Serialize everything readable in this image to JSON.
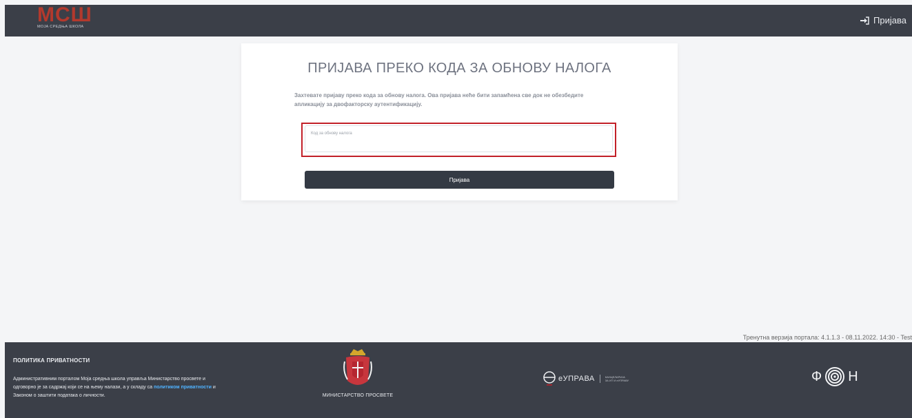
{
  "header": {
    "logo_text": "МСШ",
    "logo_subtitle": "МОЈА СРЕДЊА ШКОЛА",
    "login_label": "Пријава",
    "login_icon": "sign-in-icon"
  },
  "card": {
    "title": "ПРИЈАВА ПРЕКО КОДА ЗА ОБНОВУ НАЛОГА",
    "description": "Захтевате пријаву преко кода за обнову налога. Ова пријава неће бити запамћена све док не обезбедите апликацију за двофакторску аутентификацију.",
    "field_label": "Код за обнову налога",
    "field_value": "",
    "submit_label": "Пријава"
  },
  "version_text": "Тренутна верзија портала: 4.1.1.3 - 08.11.2022. 14:30 - Test",
  "footer": {
    "privacy_title": "ПОЛИТИКА ПРИВАТНОСТИ",
    "privacy_text_before": "Административним порталом Моја средња школа управља Министарство просвете и одговорно је за садржај који се на њему налази, а у складу са ",
    "privacy_link": "политиком приватности",
    "privacy_text_after": " и Законом о заштити података о личности.",
    "ministry_label": "МИНИСТАРСТВО ПРОСВЕТЕ",
    "euprava_name": "eУПРАВА",
    "euprava_sub1": "КАНЦЕЛАРИЈА",
    "euprava_sub2": "ЗА ИТ И еУПРАВУ",
    "fon_left": "Ф",
    "fon_right": "Н"
  },
  "colors": {
    "header_bg": "#3b3f48",
    "highlight": "#c21f27",
    "button_bg": "#343a44",
    "link": "#4fb2ff"
  }
}
